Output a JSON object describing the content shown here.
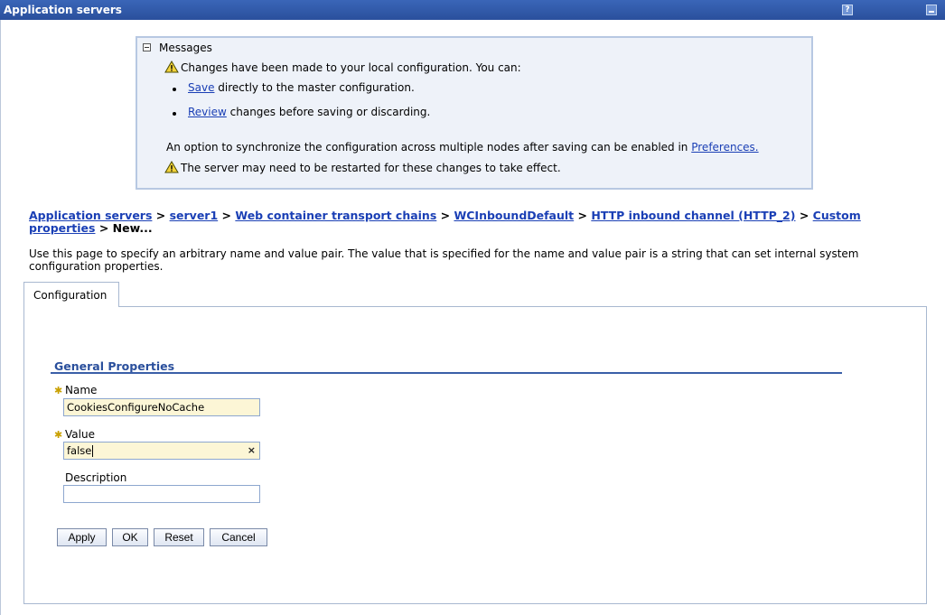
{
  "window": {
    "title": "Application servers",
    "help_label": "?"
  },
  "messages": {
    "title": "Messages",
    "changes_text": "Changes have been made to your local configuration. You can:",
    "save_link": "Save",
    "save_rest": " directly to the master configuration.",
    "review_link": "Review",
    "review_rest": " changes before saving or discarding.",
    "sync_text": "An option to synchronize the configuration across multiple nodes after saving can be enabled in ",
    "preferences_link": "Preferences.",
    "restart_text": "The server may need to be restarted for these changes to take effect."
  },
  "breadcrumb": {
    "items": [
      "Application servers",
      "server1",
      "Web container transport chains",
      "WCInboundDefault",
      "HTTP inbound channel (HTTP_2)",
      "Custom properties"
    ],
    "separator": " > ",
    "current": "New..."
  },
  "page_description": "Use this page to specify an arbitrary name and value pair. The value that is specified for the name and value pair is a string that can set internal system configuration properties.",
  "tabs": [
    {
      "label": "Configuration"
    }
  ],
  "general_properties": {
    "title": "General Properties",
    "name_label": "Name",
    "name_value": "CookiesConfigureNoCache",
    "value_label": "Value",
    "value_value": "false",
    "description_label": "Description",
    "description_value": ""
  },
  "buttons": {
    "apply": "Apply",
    "ok": "OK",
    "reset": "Reset",
    "cancel": "Cancel"
  },
  "colors": {
    "titlebar": "#2a4f9c",
    "link": "#1a3fb5",
    "message_bg": "#eef2f9",
    "field_filled": "#fcf6d6",
    "required": "#c9a000"
  },
  "icons": {
    "warning": "warning-icon",
    "required": "required-asterisk-icon",
    "clear": "clear-icon"
  }
}
